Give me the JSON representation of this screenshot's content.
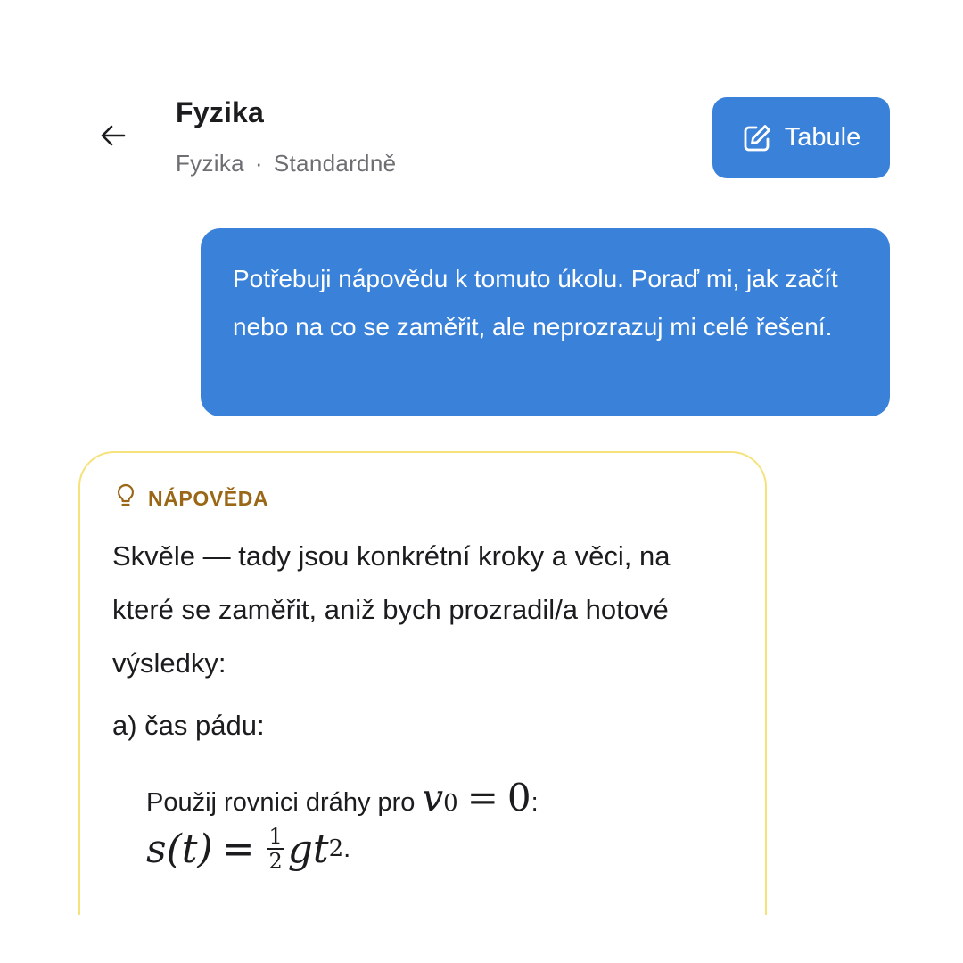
{
  "header": {
    "back_icon": "arrow-left-icon",
    "title": "Fyzika",
    "subtitle_subject": "Fyzika",
    "subtitle_separator": "·",
    "subtitle_mode": "Standardně",
    "whiteboard_button": {
      "icon": "edit-square-icon",
      "label": "Tabule"
    }
  },
  "user_message": {
    "text": "Potřebuji nápovědu k tomuto úkolu. Poraď mi, jak začít nebo na co se zaměřit, ale neprozrazuj mi celé řešení."
  },
  "hint": {
    "icon": "lightbulb-icon",
    "label": "NÁPOVĚDA",
    "intro": "Skvěle — tady jsou konkrétní kroky a věci, na které se zaměřit, aniž bych prozradil/a hotové výsledky:",
    "step_title": "a) čas pádu:",
    "step_text": "Použij rovnici dráhy pro",
    "step_math_var": "v",
    "step_math_sub": "0",
    "step_math_eq": "=",
    "step_math_val": "0",
    "step_colon": ":",
    "formula": {
      "lhs": "s(t)",
      "eq": "=",
      "frac_num": "1",
      "frac_den": "2",
      "rhs": "gt",
      "exp": "2",
      "end": "."
    }
  },
  "colors": {
    "accent": "#3a82d9",
    "hint_border": "#f5e27a",
    "hint_label": "#9a6717"
  }
}
